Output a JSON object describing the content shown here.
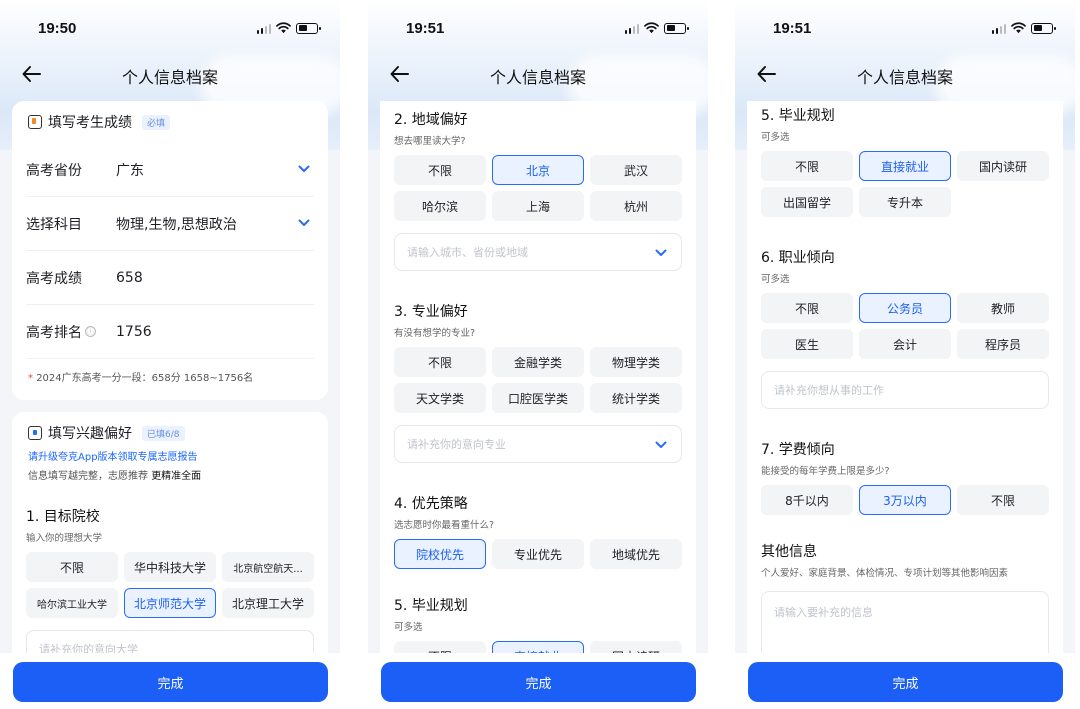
{
  "screens": [
    {
      "status_time": "19:50",
      "nav_title": "个人信息档案",
      "score_card": {
        "title": "填写考生成绩",
        "tag": "必填",
        "province": {
          "label": "高考省份",
          "value": "广东"
        },
        "subjects": {
          "label": "选择科目",
          "value": "物理,生物,思想政治"
        },
        "score": {
          "label": "高考成绩",
          "value": "658"
        },
        "rank": {
          "label": "高考排名",
          "info_icon": "ⓘ",
          "value": "1756"
        },
        "hint_star": "*",
        "hint": "2024广东高考一分一段：658分 1658~1756名"
      },
      "interest_card": {
        "title": "填写兴趣偏好",
        "tag": "已填6/8",
        "promo_link": "请升级夸克App版本领取专属志愿报告",
        "promo_sub_prefix": "信息填写越完整，志愿推荐",
        "promo_sub_emph": "更精准全面",
        "target": {
          "title": "1. 目标院校",
          "subtitle": "输入你的理想大学",
          "options": [
            {
              "label": "不限",
              "selected": false
            },
            {
              "label": "华中科技大学",
              "selected": false
            },
            {
              "label": "北京航空航天...",
              "selected": false
            },
            {
              "label": "哈尔滨工业大学",
              "selected": false
            },
            {
              "label": "北京师范大学",
              "selected": true
            },
            {
              "label": "北京理工大学",
              "selected": false
            }
          ],
          "input_placeholder": "请补充你的意向大学"
        }
      },
      "done_label": "完成"
    },
    {
      "status_time": "19:51",
      "nav_title": "个人信息档案",
      "region": {
        "title": "2. 地域偏好",
        "subtitle": "想去哪里读大学?",
        "options": [
          {
            "label": "不限",
            "selected": false
          },
          {
            "label": "北京",
            "selected": true
          },
          {
            "label": "武汉",
            "selected": false
          },
          {
            "label": "哈尔滨",
            "selected": false
          },
          {
            "label": "上海",
            "selected": false
          },
          {
            "label": "杭州",
            "selected": false
          }
        ],
        "input_placeholder": "请输入城市、省份或地域"
      },
      "major": {
        "title": "3. 专业偏好",
        "subtitle": "有没有想学的专业?",
        "options": [
          {
            "label": "不限",
            "selected": false
          },
          {
            "label": "金融学类",
            "selected": false
          },
          {
            "label": "物理学类",
            "selected": false
          },
          {
            "label": "天文学类",
            "selected": false
          },
          {
            "label": "口腔医学类",
            "selected": false
          },
          {
            "label": "统计学类",
            "selected": false
          }
        ],
        "input_placeholder": "请补充你的意向专业"
      },
      "strategy": {
        "title": "4. 优先策略",
        "subtitle": "选志愿时你最看重什么?",
        "options": [
          {
            "label": "院校优先",
            "selected": true
          },
          {
            "label": "专业优先",
            "selected": false
          },
          {
            "label": "地域优先",
            "selected": false
          }
        ]
      },
      "plan_preview": {
        "title": "5. 毕业规划",
        "subtitle": "可多选",
        "options": [
          {
            "label": "不限",
            "selected": false
          },
          {
            "label": "直接就业",
            "selected": true
          },
          {
            "label": "国内读研",
            "selected": false
          }
        ]
      },
      "done_label": "完成"
    },
    {
      "status_time": "19:51",
      "nav_title": "个人信息档案",
      "plan": {
        "title": "5. 毕业规划",
        "subtitle": "可多选",
        "options": [
          {
            "label": "不限",
            "selected": false
          },
          {
            "label": "直接就业",
            "selected": true
          },
          {
            "label": "国内读研",
            "selected": false
          },
          {
            "label": "出国留学",
            "selected": false
          },
          {
            "label": "专升本",
            "selected": false
          }
        ]
      },
      "career": {
        "title": "6. 职业倾向",
        "subtitle": "可多选",
        "options": [
          {
            "label": "不限",
            "selected": false
          },
          {
            "label": "公务员",
            "selected": true
          },
          {
            "label": "教师",
            "selected": false
          },
          {
            "label": "医生",
            "selected": false
          },
          {
            "label": "会计",
            "selected": false
          },
          {
            "label": "程序员",
            "selected": false
          }
        ],
        "input_placeholder": "请补充你想从事的工作"
      },
      "tuition": {
        "title": "7. 学费倾向",
        "subtitle": "能接受的每年学费上限是多少?",
        "options": [
          {
            "label": "8千以内",
            "selected": false
          },
          {
            "label": "3万以内",
            "selected": true
          },
          {
            "label": "不限",
            "selected": false
          }
        ]
      },
      "other": {
        "title": "其他信息",
        "subtitle": "个人爱好、家庭背景、体检情况、专项计划等其他影响因素",
        "input_placeholder": "请输入要补充的信息"
      },
      "done_label": "完成"
    }
  ],
  "colors": {
    "accent": "#1b5ff6",
    "selected_border": "#2a6cf6",
    "selected_bg": "#eaf2ff",
    "chip_bg": "#f3f4f6",
    "page_bg": "#f3f5f8",
    "required_star": "#e5484d"
  },
  "icons": {
    "back": "back-arrow-icon",
    "dropdown": "chevron-down-icon",
    "signal": "signal-icon",
    "wifi": "wifi-icon",
    "battery": "battery-icon"
  }
}
